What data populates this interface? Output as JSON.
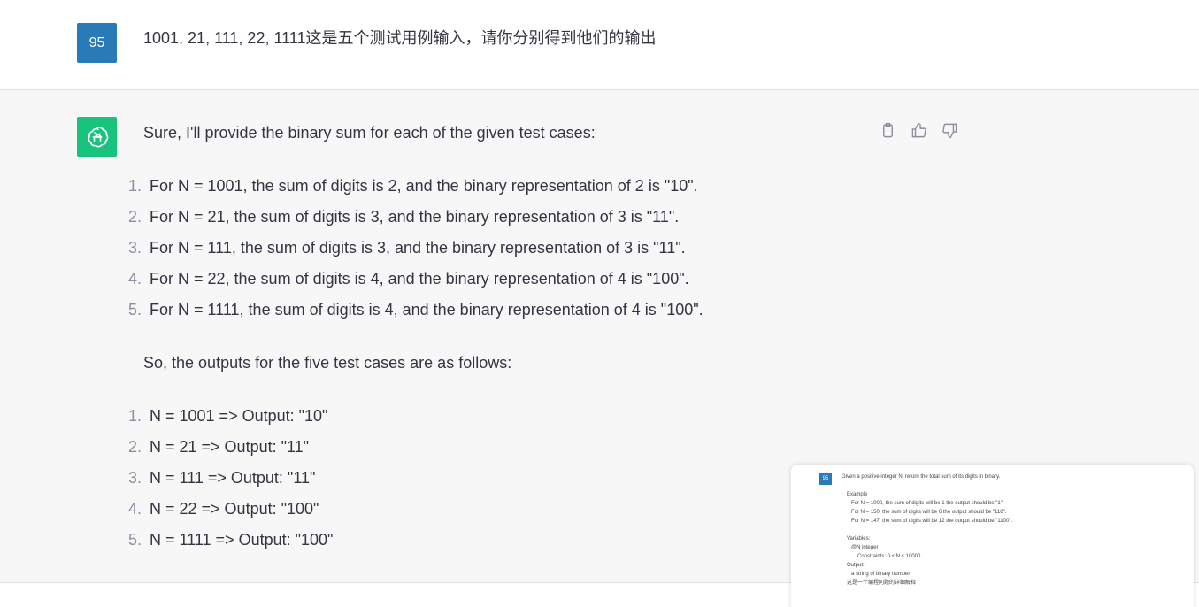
{
  "user_message": {
    "avatar_label": "95",
    "text": "1001, 21, 111, 22, 1111这是五个测试用例输入，请你分别得到他们的输出"
  },
  "assistant_message": {
    "intro": "Sure, I'll provide the binary sum for each of the given test cases:",
    "list1": [
      {
        "num": "1.",
        "text": "For N = 1001, the sum of digits is 2, and the binary representation of 2 is \"10\"."
      },
      {
        "num": "2.",
        "text": "For N = 21, the sum of digits is 3, and the binary representation of 3 is \"11\"."
      },
      {
        "num": "3.",
        "text": "For N = 111, the sum of digits is 3, and the binary representation of 3 is \"11\"."
      },
      {
        "num": "4.",
        "text": "For N = 22, the sum of digits is 4, and the binary representation of 4 is \"100\"."
      },
      {
        "num": "5.",
        "text": "For N = 1111, the sum of digits is 4, and the binary representation of 4 is \"100\"."
      }
    ],
    "summary": "So, the outputs for the five test cases are as follows:",
    "list2": [
      {
        "num": "1.",
        "text": "N = 1001 => Output: \"10\""
      },
      {
        "num": "2.",
        "text": "N = 21 => Output: \"11\""
      },
      {
        "num": "3.",
        "text": "N = 111 => Output: \"11\""
      },
      {
        "num": "4.",
        "text": "N = 22 => Output: \"100\""
      },
      {
        "num": "5.",
        "text": "N = 1111 => Output: \"100\""
      }
    ],
    "actions": [
      "copy-icon",
      "thumbs-up-icon",
      "thumbs-down-icon"
    ]
  },
  "thumbnail": {
    "avatar_label": "95",
    "lines": [
      "Given a positive integer N, return the total sum of its digits in binary.",
      "Example",
      "For N = 1000, the sum of digits will be 1 the output should be \"1\".",
      "For N = 150, the sum of digits will be 6 the output should be \"110\".",
      "For N = 147, the sum of digits will be 12 the output should be \"1100\".",
      "Variables:",
      "@N integer",
      "Constraints: 0 ≤ N ≤ 10000.",
      "Output:",
      "a string of binary number",
      "这是一个编程问题的详细解释"
    ]
  },
  "colors": {
    "user_avatar": "#2a7ab8",
    "bot_avatar": "#19c37d",
    "assistant_bg": "#f7f7f8",
    "text": "#343541"
  }
}
